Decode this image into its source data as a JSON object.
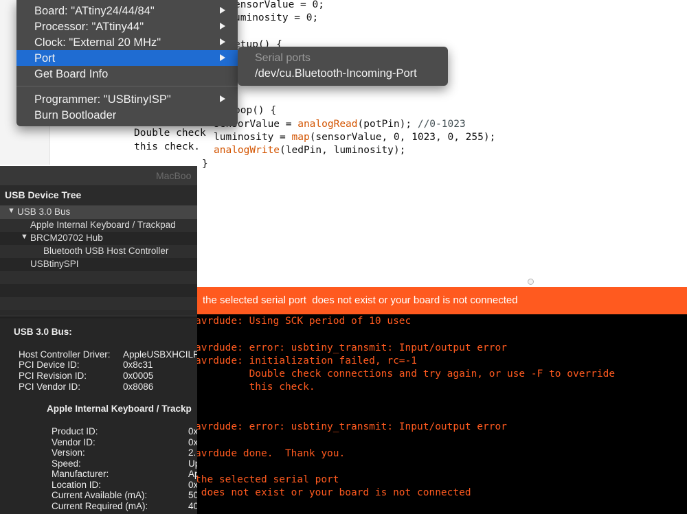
{
  "editor": {
    "lines": [
      {
        "segments": [
          {
            "t": "ensorValue = 0;",
            "c": ""
          }
        ]
      },
      {
        "segments": [
          {
            "t": "uminosity = 0;",
            "c": ""
          }
        ]
      },
      {
        "segments": [
          {
            "t": "etup() {",
            "c": ""
          }
        ]
      },
      {
        "segments": [
          {
            "t": "oop() {",
            "c": ""
          }
        ]
      },
      {
        "segments": [
          {
            "t": "sensorValue = ",
            "c": ""
          },
          {
            "t": "analogRead",
            "c": "fn"
          },
          {
            "t": "(potPin); ",
            "c": ""
          },
          {
            "t": "//0-1023",
            "c": "cm"
          }
        ]
      },
      {
        "segments": [
          {
            "t": "luminosity = ",
            "c": ""
          },
          {
            "t": "map",
            "c": "fn"
          },
          {
            "t": "(sensorValue, 0, 1023, 0, 255);",
            "c": ""
          }
        ]
      },
      {
        "segments": [
          {
            "t": "analogWrite",
            "c": "fn"
          },
          {
            "t": "(ledPin, luminosity);",
            "c": ""
          }
        ]
      },
      {
        "segments": [
          {
            "t": "}",
            "c": ""
          }
        ]
      }
    ],
    "faded_lines": [
      "Double check",
      "this check."
    ]
  },
  "banner": {
    "text": "the selected serial port  does not exist or your board is not connected"
  },
  "console": {
    "lines": [
      "avrdude: Using SCK period of 10 usec",
      "avrdude: error: usbtiny_transmit: Input/output error",
      "avrdude: initialization failed, rc=-1",
      "         Double check connections and try again, or use -F to override",
      "         this check.",
      "avrdude: error: usbtiny_transmit: Input/output error",
      "avrdude done.  Thank you.",
      "the selected serial port",
      " does not exist or your board is not connected"
    ]
  },
  "menu": {
    "items": [
      {
        "label": "Board: \"ATtiny24/44/84\"",
        "submenu": true,
        "highlighted": false
      },
      {
        "label": "Processor: \"ATtiny44\"",
        "submenu": true,
        "highlighted": false
      },
      {
        "label": "Clock: \"External 20 MHz\"",
        "submenu": true,
        "highlighted": false
      },
      {
        "label": "Port",
        "submenu": true,
        "highlighted": true
      },
      {
        "label": "Get Board Info",
        "submenu": false,
        "highlighted": false
      },
      {
        "label": "Programmer: \"USBtinyISP\"",
        "submenu": true,
        "highlighted": false
      },
      {
        "label": "Burn Bootloader",
        "submenu": false,
        "highlighted": false
      }
    ],
    "highlight_color": "#1f6cd2"
  },
  "submenu": {
    "header": "Serial ports",
    "port": "/dev/cu.Bluetooth-Incoming-Port"
  },
  "sysinfo": {
    "window_title": "MacBoo",
    "tree_header": "USB Device Tree",
    "tree": [
      {
        "label": "USB 3.0 Bus",
        "level": 0,
        "expanded": true,
        "selected": true
      },
      {
        "label": "Apple Internal Keyboard / Trackpad",
        "level": 1,
        "expanded": null,
        "selected": false
      },
      {
        "label": "BRCM20702 Hub",
        "level": 0.5,
        "expanded": true,
        "selected": false
      },
      {
        "label": "Bluetooth USB Host Controller",
        "level": 2,
        "expanded": null,
        "selected": false
      },
      {
        "label": "USBtinySPI",
        "level": 1,
        "expanded": null,
        "selected": false
      }
    ],
    "detail_title": "USB 3.0 Bus:",
    "bus_props": [
      {
        "k": "Host Controller Driver:",
        "v": "AppleUSBXHCILP"
      },
      {
        "k": "PCI Device ID:",
        "v": "0x8c31"
      },
      {
        "k": "PCI Revision ID:",
        "v": "0x0005"
      },
      {
        "k": "PCI Vendor ID:",
        "v": "0x8086"
      }
    ],
    "device_title": "Apple Internal Keyboard / Trackp",
    "device_props": [
      {
        "k": "Product ID:",
        "v": "0x"
      },
      {
        "k": "Vendor ID:",
        "v": "0x"
      },
      {
        "k": "Version:",
        "v": "2."
      },
      {
        "k": "Speed:",
        "v": "Up"
      },
      {
        "k": "Manufacturer:",
        "v": "Ap"
      },
      {
        "k": "Location ID:",
        "v": "0x"
      },
      {
        "k": "Current Available (mA):",
        "v": "50"
      },
      {
        "k": "Current Required (mA):",
        "v": "40"
      }
    ]
  },
  "colors": {
    "error_orange": "#ff5a1f",
    "arduino_function": "#d35400"
  }
}
